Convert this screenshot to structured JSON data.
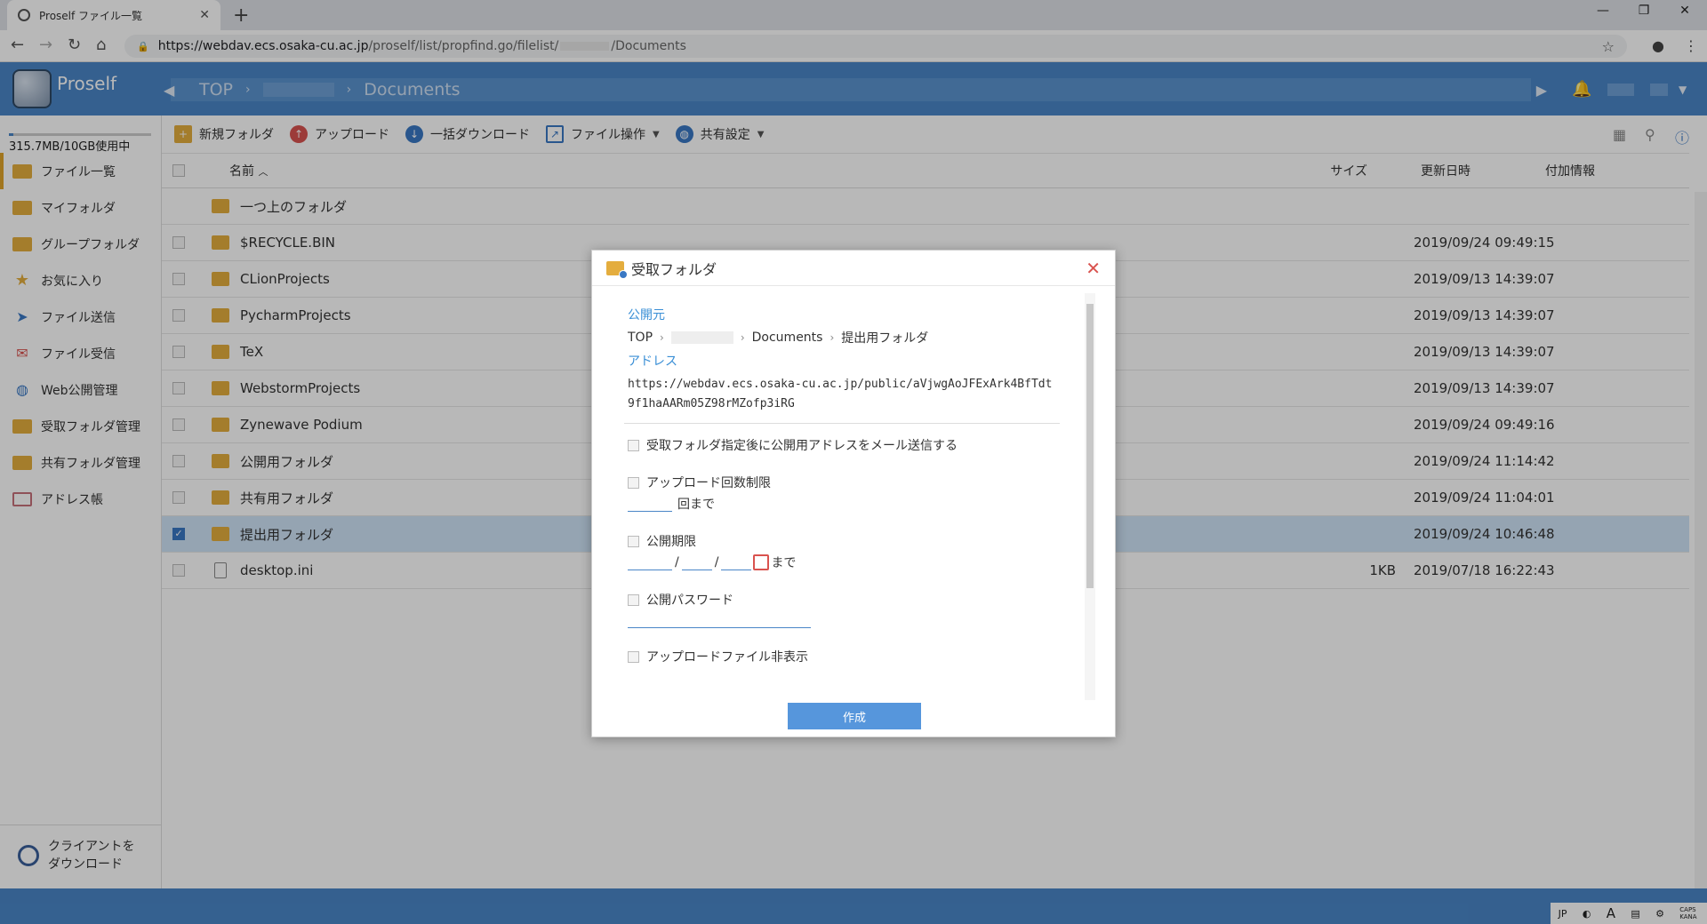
{
  "browser": {
    "tab_title": "Proself ファイル一覧",
    "new_tab": "+",
    "url_prefix": "https://webdav.ecs.osaka-cu.ac.jp",
    "url_path": "/proself/list/propfind.go/filelist/",
    "url_suffix": "/Documents"
  },
  "app": {
    "name": "Proself",
    "breadcrumb": {
      "root": "TOP",
      "current": "Documents"
    }
  },
  "sidebar": {
    "quota": "315.7MB/10GB使用中",
    "quota_fraction": 0.031,
    "items": [
      {
        "label": "ファイル一覧",
        "icon": "folder-icon"
      },
      {
        "label": "マイフォルダ",
        "icon": "my-folder-icon"
      },
      {
        "label": "グループフォルダ",
        "icon": "group-folder-icon"
      },
      {
        "label": "お気に入り",
        "icon": "star-icon"
      },
      {
        "label": "ファイル送信",
        "icon": "paper-plane-icon"
      },
      {
        "label": "ファイル受信",
        "icon": "mailbox-icon"
      },
      {
        "label": "Web公開管理",
        "icon": "globe-icon"
      },
      {
        "label": "受取フォルダ管理",
        "icon": "receive-folder-icon"
      },
      {
        "label": "共有フォルダ管理",
        "icon": "shared-folder-icon"
      },
      {
        "label": "アドレス帳",
        "icon": "address-book-icon"
      }
    ],
    "client_download_line1": "クライアントを",
    "client_download_line2": "ダウンロード"
  },
  "actions": {
    "new_folder": "新規フォルダ",
    "upload": "アップロード",
    "bulk_download": "一括ダウンロード",
    "file_ops": "ファイル操作",
    "share_settings": "共有設定"
  },
  "list": {
    "headers": {
      "name": "名前",
      "size": "サイズ",
      "date": "更新日時",
      "info": "付加情報"
    },
    "rows": [
      {
        "name": "一つ上のフォルダ",
        "size": "",
        "date": ""
      },
      {
        "name": "$RECYCLE.BIN",
        "size": "",
        "date": "2019/09/24 09:49:15"
      },
      {
        "name": "CLionProjects",
        "size": "",
        "date": "2019/09/13 14:39:07"
      },
      {
        "name": "PycharmProjects",
        "size": "",
        "date": "2019/09/13 14:39:07"
      },
      {
        "name": "TeX",
        "size": "",
        "date": "2019/09/13 14:39:07"
      },
      {
        "name": "WebstormProjects",
        "size": "",
        "date": "2019/09/13 14:39:07"
      },
      {
        "name": "Zynewave Podium",
        "size": "",
        "date": "2019/09/24 09:49:16"
      },
      {
        "name": "公開用フォルダ",
        "size": "",
        "date": "2019/09/24 11:14:42"
      },
      {
        "name": "共有用フォルダ",
        "size": "",
        "date": "2019/09/24 11:04:01"
      },
      {
        "name": "提出用フォルダ",
        "size": "",
        "date": "2019/09/24 10:46:48"
      },
      {
        "name": "desktop.ini",
        "size": "1KB",
        "date": "2019/07/18 16:22:43"
      }
    ]
  },
  "dialog": {
    "title": "受取フォルダ",
    "source_label": "公開元",
    "crumb_root": "TOP",
    "crumb_docs": "Documents",
    "crumb_folder": "提出用フォルダ",
    "address_label": "アドレス",
    "address": "https://webdav.ecs.osaka-cu.ac.jp/public/aVjwgAoJFExArk4BfTdt9f1haAARm05Z98rMZofp3iRG",
    "opt_mail": "受取フォルダ指定後に公開用アドレスをメール送信する",
    "opt_upload_limit": "アップロード回数制限",
    "upload_limit_suffix": "回まで",
    "opt_expiry": "公開期限",
    "date_sep": "/",
    "expiry_suffix": "まで",
    "opt_password": "公開パスワード",
    "opt_hide_uploads": "アップロードファイル非表示",
    "create_button": "作成"
  },
  "footer": {
    "lang": "JP",
    "caps": "CAPS KANA"
  }
}
